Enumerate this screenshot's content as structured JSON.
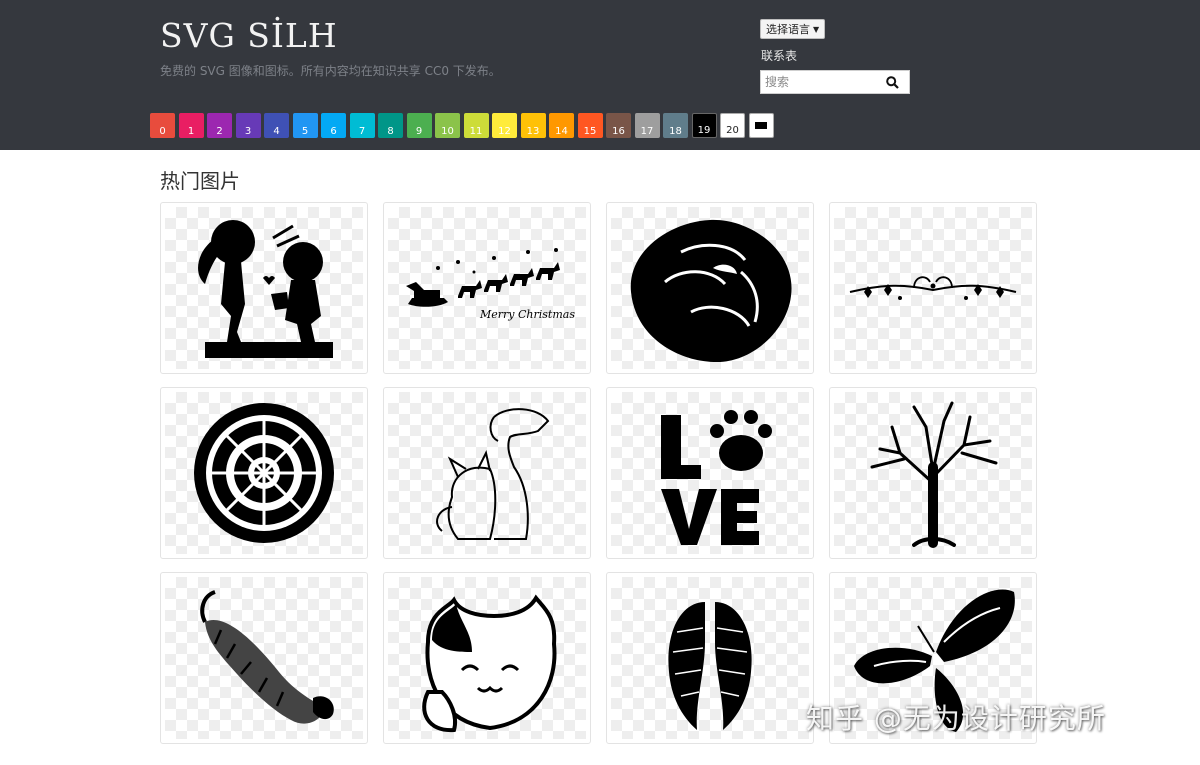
{
  "header": {
    "brand": "SVG SİLH",
    "tagline": "免费的 SVG 图像和图标。所有内容均在知识共享 CC0 下发布。",
    "language_button": "选择语言",
    "contact_link": "联系表",
    "search_placeholder": "搜索"
  },
  "colors": {
    "header_bg": "#35383e",
    "swatches": [
      "#e84c3d",
      "#e91e63",
      "#9c27b0",
      "#673ab7",
      "#3f51b5",
      "#2196f3",
      "#03a9f4",
      "#00bcd4",
      "#009688",
      "#4caf50",
      "#8bc34a",
      "#cddc39",
      "#ffeb3b",
      "#ffc107",
      "#ff9800",
      "#ff5722",
      "#795548",
      "#9e9e9e",
      "#607d8b",
      "#000000",
      "#ffffff"
    ]
  },
  "swatch_labels": [
    "0",
    "1",
    "2",
    "3",
    "4",
    "5",
    "6",
    "7",
    "8",
    "9",
    "10",
    "11",
    "12",
    "13",
    "14",
    "15",
    "16",
    "17",
    "18",
    "19",
    "20"
  ],
  "main": {
    "section_title": "热门图片",
    "images": [
      {
        "icon": "couple-silhouette-icon"
      },
      {
        "icon": "santa-sleigh-icon",
        "caption": "Merry Christmas"
      },
      {
        "icon": "rose-icon"
      },
      {
        "icon": "flourish-divider-icon"
      },
      {
        "icon": "mandala-icon"
      },
      {
        "icon": "dog-cat-outline-icon"
      },
      {
        "icon": "love-paw-icon",
        "text": "LOVE"
      },
      {
        "icon": "tree-icon"
      },
      {
        "icon": "tiger-icon"
      },
      {
        "icon": "lucky-cat-icon"
      },
      {
        "icon": "angel-wings-icon"
      },
      {
        "icon": "butterfly-icon"
      }
    ]
  },
  "watermark": "知乎 @无为设计研究所"
}
